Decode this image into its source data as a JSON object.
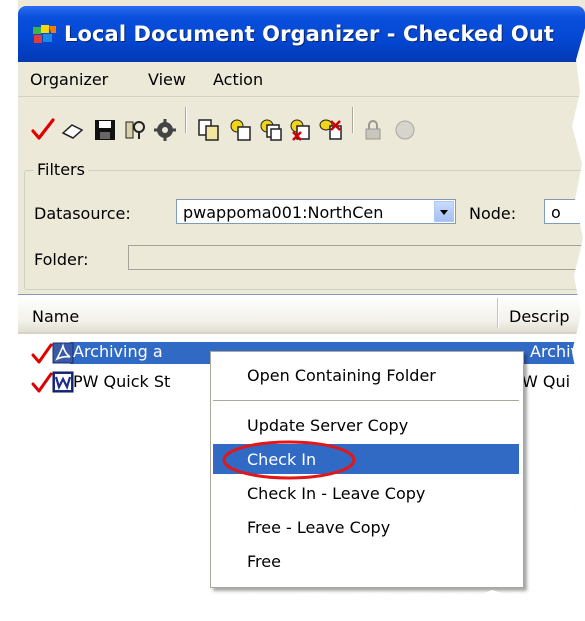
{
  "window": {
    "title": "Local Document Organizer - Checked Out"
  },
  "menu": {
    "items": [
      "Organizer",
      "View",
      "Action"
    ]
  },
  "toolbar": {
    "icons": [
      "checkmark-icon",
      "eraser-icon",
      "save-icon",
      "tools-icon",
      "gear-icon",
      "copy-document-icon",
      "copy-document-2-icon",
      "copy-multiple-icon",
      "delete-copy-icon",
      "free-document-icon",
      "lock-icon",
      "globe-icon"
    ]
  },
  "filters": {
    "legend": "Filters",
    "datasource_label": "Datasource:",
    "datasource_value": "pwappoma001:NorthCen",
    "node_label": "Node:",
    "node_value": "o",
    "folder_label": "Folder:",
    "folder_value": ""
  },
  "list": {
    "columns": [
      "Name",
      "Descrip"
    ],
    "rows": [
      {
        "name": "Archiving a Project from ProjectWise - Archiv",
        "visible_name": "Archiving a",
        "description": "Archiv",
        "selected": true,
        "file_type": "pdf"
      },
      {
        "name": "PW Quick Start",
        "visible_name": "PW Quick St",
        "description": "W Qui",
        "selected": false,
        "file_type": "word"
      }
    ]
  },
  "context_menu": {
    "items": [
      {
        "label": "Open Containing Folder",
        "group": 1
      },
      {
        "label": "Update Server Copy",
        "group": 2
      },
      {
        "label": "Check In",
        "group": 2,
        "highlighted": true,
        "annotated": true
      },
      {
        "label": "Check In - Leave Copy",
        "group": 2
      },
      {
        "label": "Free - Leave Copy",
        "group": 2
      },
      {
        "label": "Free",
        "group": 2
      }
    ]
  },
  "colors": {
    "title_bar": "#0347d3",
    "selection": "#316ac5",
    "annotation": "#e01818",
    "checkmark": "#e00000"
  }
}
